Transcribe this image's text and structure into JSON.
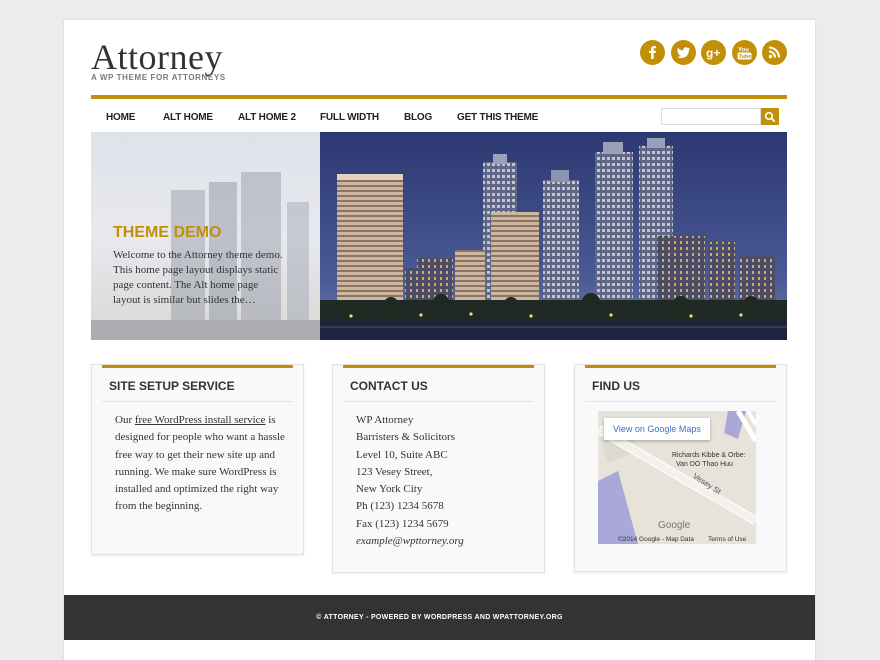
{
  "site": {
    "title": "Attorney",
    "tagline": "A WP THEME FOR ATTORNEYS"
  },
  "social": [
    {
      "icon": "facebook-icon",
      "glyph": "f"
    },
    {
      "icon": "twitter-icon",
      "glyph": "t"
    },
    {
      "icon": "google-plus-icon",
      "glyph": "g+"
    },
    {
      "icon": "youtube-icon",
      "glyph": "You Tube"
    },
    {
      "icon": "rss-icon",
      "glyph": "rss"
    }
  ],
  "nav": {
    "items": [
      "HOME",
      "ALT HOME",
      "ALT HOME 2",
      "FULL WIDTH",
      "BLOG",
      "GET THIS THEME"
    ],
    "search_placeholder": ""
  },
  "hero": {
    "title": "THEME DEMO",
    "text": "Welcome to the Attorney theme demo. This home page layout displays static page content. The Alt home page layout is similar but slides the…"
  },
  "widgets": {
    "setup": {
      "title": "SITE SETUP SERVICE",
      "text_before": "Our ",
      "link": "free WordPress install service",
      "text_after": " is designed for people who want a hassle free way to get their new site up and running. We make sure WordPress is installed and optimized the right way from the beginning."
    },
    "contact": {
      "title": "CONTACT US",
      "lines": [
        "WP Attorney",
        "Barristers & Solicitors",
        "Level 10, Suite ABC",
        "123 Vesey Street,",
        "New York City",
        "Ph (123) 1234 5678",
        "Fax (123) 1234 5679"
      ],
      "email": "example@wpttorney.org"
    },
    "find": {
      "title": "FIND US",
      "map_button": "View on Google Maps",
      "map_place": "Richards Kibbe & Orbe:\nVan DO Thao Huu",
      "map_street": "Vesey St",
      "map_logo": "Google",
      "map_copyright": "©2014 Google - Map Data",
      "map_terms": "Terms of Use"
    }
  },
  "footer": {
    "text": "© ATTORNEY - POWERED BY WORDPRESS AND WPATTORNEY.ORG"
  },
  "colors": {
    "accent": "#c19008",
    "footer_bg": "#333333",
    "page_bg": "#ececec"
  }
}
